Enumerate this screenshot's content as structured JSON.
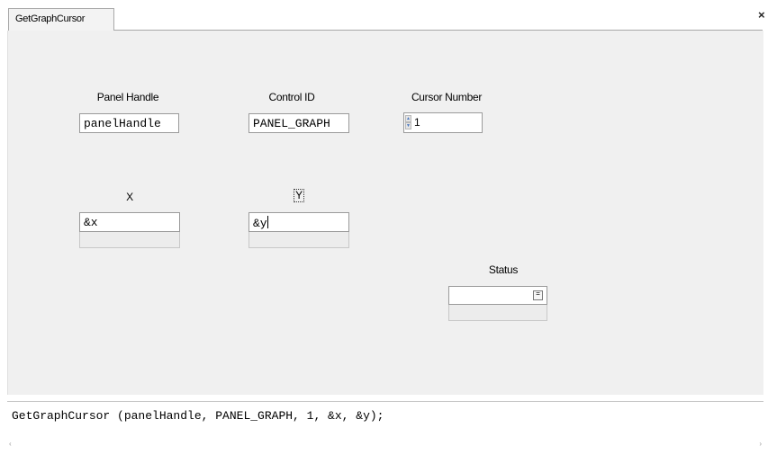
{
  "tab": {
    "title": "GetGraphCursor",
    "close_glyph": "×"
  },
  "fields": {
    "panel_handle": {
      "label": "Panel Handle",
      "value": "panelHandle"
    },
    "control_id": {
      "label": "Control ID",
      "value": "PANEL_GRAPH"
    },
    "cursor_number": {
      "label": "Cursor Number",
      "value": "1"
    },
    "x": {
      "label": "X",
      "value": "&x"
    },
    "y": {
      "label": "Y",
      "value": "&y"
    },
    "status": {
      "label": "Status",
      "value": "",
      "button_glyph": "="
    }
  },
  "code_preview": "GetGraphCursor (panelHandle, PANEL_GRAPH, 1, &x, &y);",
  "scroll": {
    "left_glyph": "‹",
    "right_glyph": "›"
  }
}
